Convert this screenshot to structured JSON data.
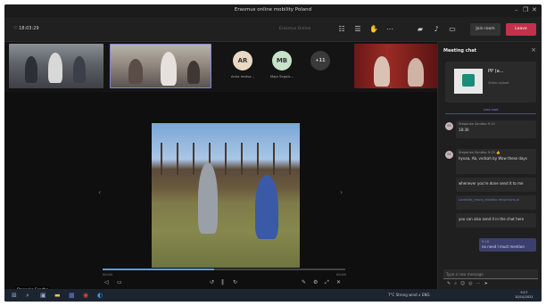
{
  "window": {
    "title": "Erasmus online mobility Poland"
  },
  "toolbar": {
    "meeting_timer": "18:03:29",
    "meeting_name": "Erasmus Online",
    "more_label": "Join room",
    "leave_label": "Leave"
  },
  "participants": [
    {
      "initials": "AR",
      "name": "Anka matsa...",
      "color": "#e9d8c3"
    },
    {
      "initials": "MB",
      "name": "Maja Segals...",
      "color": "#c6e3c9"
    },
    {
      "initials": "+11",
      "name": "",
      "color": "#3a3a3a"
    }
  ],
  "stage": {
    "presenter_name": "Stepanka Sandbo",
    "time_elapsed": "00:00",
    "time_total": "00:00",
    "progress": 0.46
  },
  "chat": {
    "title": "Meeting chat",
    "file_name": "PP (a...",
    "file_sub": "Video upload",
    "last_read": "Last read",
    "messages": [
      {
        "author": "Stepanka Sandbo",
        "time": "9:15",
        "initials": "SS",
        "text": "18:30",
        "link": ""
      },
      {
        "author": "Stepanka Sandbo",
        "time": "9:15",
        "initials": "SS",
        "text": "hyvaa, Ab, vvdsah by Wow these days",
        "link": ""
      },
      {
        "author": "",
        "time": "",
        "initials": "",
        "text": "whenever you're done send it to me",
        "link": ""
      },
      {
        "author": "",
        "time": "",
        "initials": "",
        "text": "",
        "link": "Lambito_mura_dinatho edu/mura.pl"
      },
      {
        "author": "",
        "time": "",
        "initials": "",
        "text": "you can also send it in the chat here",
        "link": ""
      }
    ],
    "own_message_time": "9:16",
    "own_message": "no need I must mention",
    "compose_placeholder": "Type a new message"
  },
  "taskbar": {
    "tray_text": "7°C Strong wind  ∧  ENG",
    "clock_time": "9:17",
    "clock_date": "10/10/2021"
  },
  "colors": {
    "accent": "#7f86d8",
    "leave": "#c4314b",
    "background": "#141414"
  }
}
